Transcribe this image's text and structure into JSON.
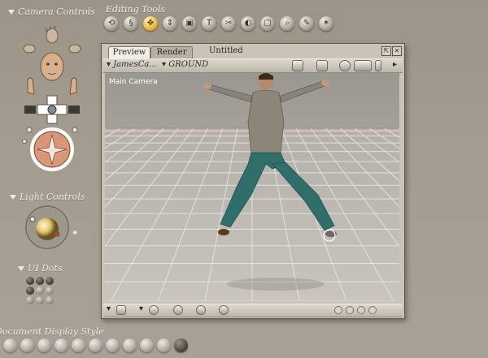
{
  "camera_controls": {
    "label": "Camera Controls"
  },
  "editing_tools": {
    "label": "Editing Tools",
    "tools": [
      {
        "icon": "rotate-icon",
        "glyph": "⟲"
      },
      {
        "icon": "twist-icon",
        "glyph": "§"
      },
      {
        "icon": "translate-icon",
        "glyph": "✥"
      },
      {
        "icon": "translate-in-out-icon",
        "glyph": "⇕"
      },
      {
        "icon": "scale-icon",
        "glyph": "▣"
      },
      {
        "icon": "taper-icon",
        "glyph": "T"
      },
      {
        "icon": "chain-break-icon",
        "glyph": "✂"
      },
      {
        "icon": "color-icon",
        "glyph": "◐"
      },
      {
        "icon": "grouping-icon",
        "glyph": "▢"
      },
      {
        "icon": "view-magnifier-icon",
        "glyph": "⌕"
      },
      {
        "icon": "morphing-tool-icon",
        "glyph": "✎"
      },
      {
        "icon": "direct-manipulation-icon",
        "glyph": "✶"
      }
    ]
  },
  "light_controls": {
    "label": "Light Controls"
  },
  "ui_dots": {
    "label": "UI Dots"
  },
  "document_display_style": {
    "label": "Document Display Style"
  },
  "document_window": {
    "tabs": [
      "Preview",
      "Render"
    ],
    "title": "Untitled",
    "figure_menu": "JamesCa...",
    "actor_menu": "GROUND",
    "camera_label": "Main Camera"
  },
  "colors": {
    "background": "#a39c8f",
    "active_tool": "#e8b83a",
    "floor": "#c3c0b9",
    "grid": "#d9534f"
  }
}
